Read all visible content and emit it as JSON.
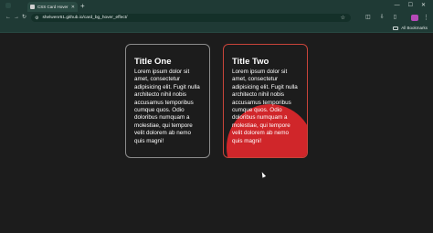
{
  "browser": {
    "tab_title": "CSS Card Hover Effect",
    "new_tab_glyph": "+",
    "url": "shelwenr61.github.io/card_bg_hover_effect/",
    "bookmarks_label": "All Bookmarks"
  },
  "cards": [
    {
      "title": "Title One",
      "body": "Lorem ipsum dolor sit amet, consectetur adipisicing elit. Fugit nulla architecto nihil nobis accusamus temporibus cumque quos. Odio doloribus numquam a molestiae, qui tempore velit dolorem ab nemo quis magni!"
    },
    {
      "title": "Title Two",
      "body": "Lorem ipsum dolor sit amet, consectetur adipisicing elit. Fugit nulla architecto nihil nobis accusamus temporibus cumque quos. Odio doloribus numquam a molestiae, qui tempore velit dolorem ab nemo quis magni!"
    }
  ],
  "colors": {
    "page_background": "#1c1c1c",
    "browser_chrome": "#1f3a35",
    "card_border": "#8b8b8b",
    "hover_accent": "#d0262a"
  },
  "icons": {
    "back": "arrow-left-icon",
    "forward": "arrow-right-icon",
    "reload": "reload-icon",
    "star": "star-icon",
    "extensions": "puzzle-icon",
    "menu": "kebab-menu-icon"
  }
}
